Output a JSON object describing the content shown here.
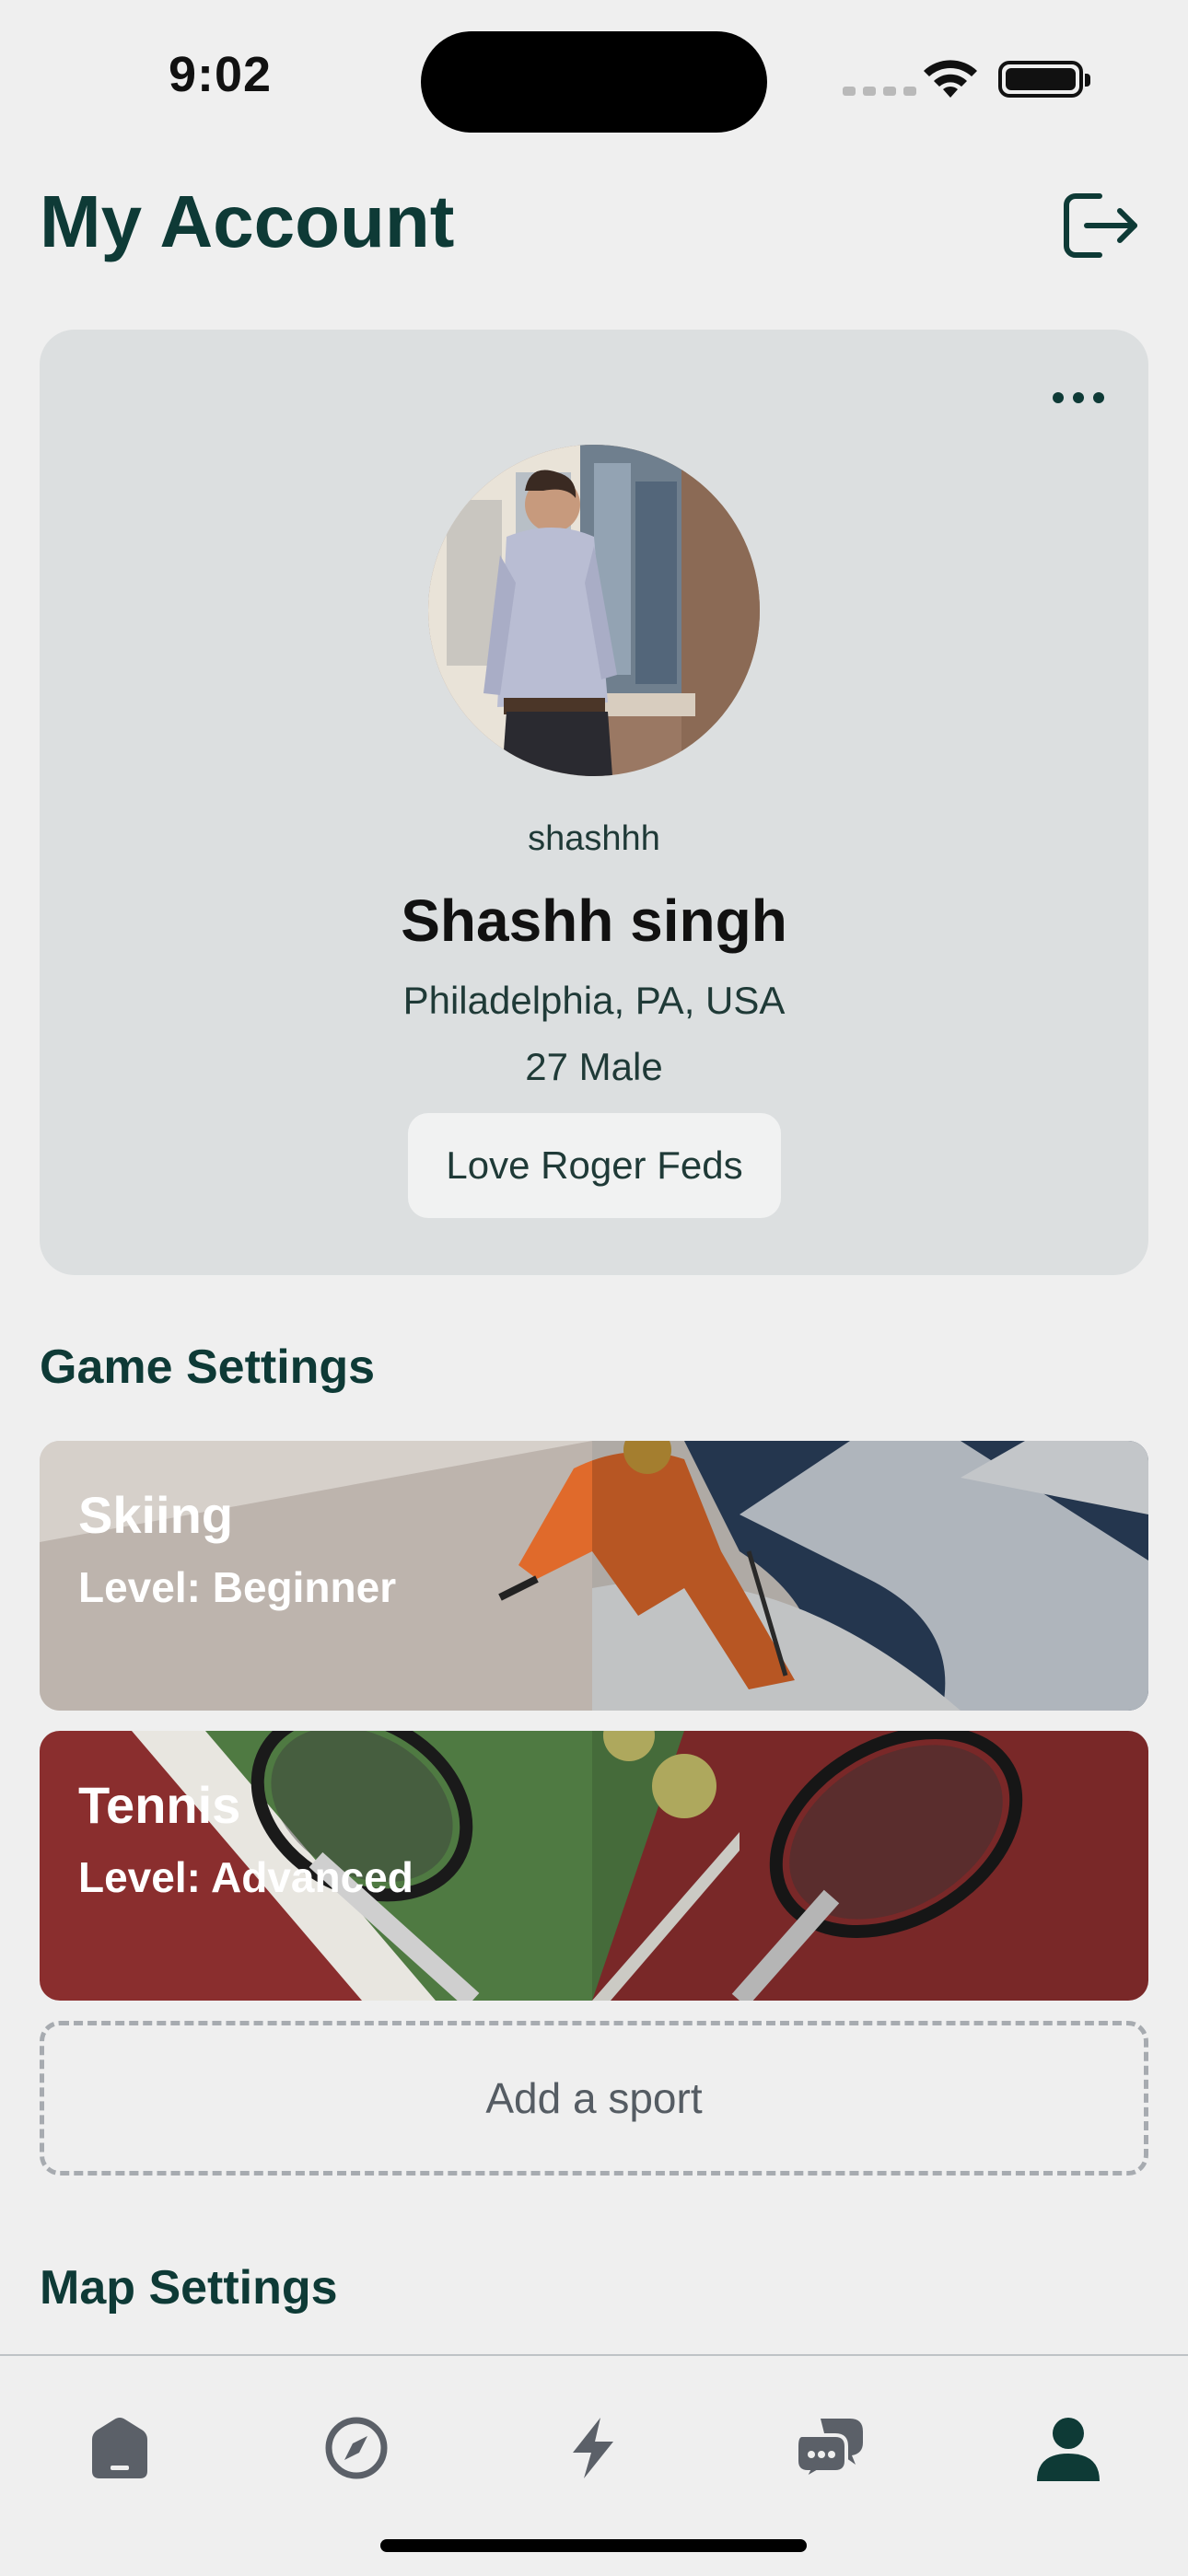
{
  "status_bar": {
    "time": "9:02"
  },
  "header": {
    "title": "My Account"
  },
  "profile": {
    "username": "shashhh",
    "full_name": "Shashh singh",
    "location": "Philadelphia, PA, USA",
    "age_gender": "27 Male",
    "bio": "Love Roger Feds"
  },
  "game_settings": {
    "title": "Game Settings",
    "sports": [
      {
        "name": "Skiing",
        "level": "Level: Beginner"
      },
      {
        "name": "Tennis",
        "level": "Level: Advanced"
      }
    ],
    "add_label": "Add a sport"
  },
  "map_settings": {
    "title": "Map Settings"
  },
  "tab_bar": {
    "items": [
      {
        "icon": "home-icon"
      },
      {
        "icon": "compass-icon"
      },
      {
        "icon": "lightning-icon"
      },
      {
        "icon": "chat-icon"
      },
      {
        "icon": "person-icon"
      }
    ],
    "active_index": 4
  },
  "colors": {
    "accent": "#0e3a36",
    "card": "#dcdfe0",
    "background": "#efefef"
  }
}
